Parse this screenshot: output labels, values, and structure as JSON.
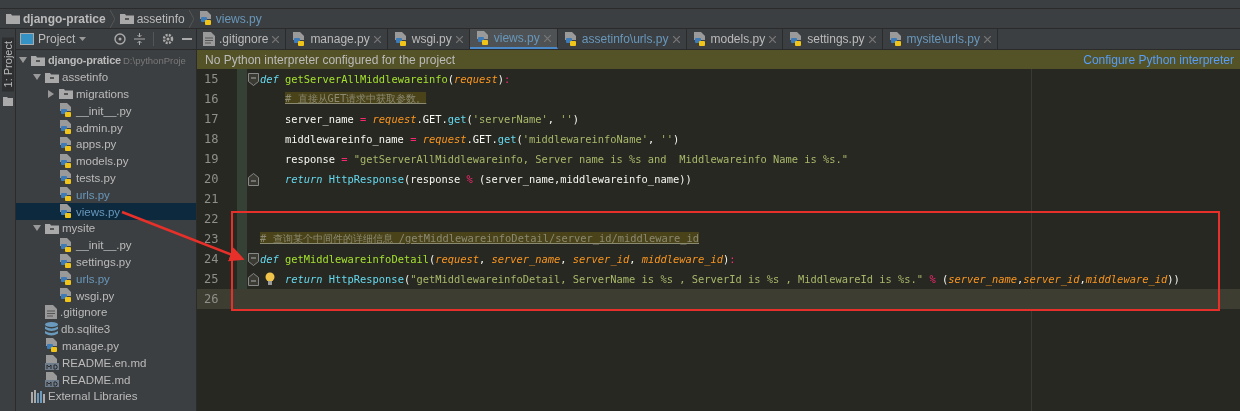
{
  "breadcrumb": [
    {
      "label": "django-pratice",
      "kind": "project",
      "modified": false
    },
    {
      "label": "assetinfo",
      "kind": "folder",
      "modified": false
    },
    {
      "label": "views.py",
      "kind": "python",
      "modified": true
    }
  ],
  "side_strip": {
    "label": "1: Project"
  },
  "project_panel": {
    "title": "Project",
    "tree": [
      {
        "label": "django-pratice",
        "path": "D:\\pythonProje",
        "kind": "folder",
        "expanded": true,
        "selected": false,
        "modified": false,
        "children": [
          {
            "label": "assetinfo",
            "kind": "folder",
            "expanded": true,
            "selected": false,
            "modified": false,
            "children": [
              {
                "label": "migrations",
                "kind": "folder",
                "expanded": false,
                "selected": false,
                "modified": false
              },
              {
                "label": "__init__.py",
                "kind": "python",
                "selected": false,
                "modified": false
              },
              {
                "label": "admin.py",
                "kind": "python",
                "selected": false,
                "modified": false
              },
              {
                "label": "apps.py",
                "kind": "python",
                "selected": false,
                "modified": false
              },
              {
                "label": "models.py",
                "kind": "python",
                "selected": false,
                "modified": false
              },
              {
                "label": "tests.py",
                "kind": "python",
                "selected": false,
                "modified": false
              },
              {
                "label": "urls.py",
                "kind": "python",
                "selected": false,
                "modified": true
              },
              {
                "label": "views.py",
                "kind": "python",
                "selected": true,
                "modified": true
              }
            ]
          },
          {
            "label": "mysite",
            "kind": "folder",
            "expanded": true,
            "selected": false,
            "modified": false,
            "children": [
              {
                "label": "__init__.py",
                "kind": "python",
                "selected": false,
                "modified": false
              },
              {
                "label": "settings.py",
                "kind": "python",
                "selected": false,
                "modified": false
              },
              {
                "label": "urls.py",
                "kind": "python",
                "selected": false,
                "modified": true
              },
              {
                "label": "wsgi.py",
                "kind": "python",
                "selected": false,
                "modified": false
              }
            ]
          },
          {
            "label": ".gitignore",
            "kind": "text",
            "selected": false,
            "modified": false
          },
          {
            "label": "db.sqlite3",
            "kind": "database",
            "selected": false,
            "modified": false
          },
          {
            "label": "manage.py",
            "kind": "python",
            "selected": false,
            "modified": false
          },
          {
            "label": "README.en.md",
            "kind": "markdown",
            "selected": false,
            "modified": false
          },
          {
            "label": "README.md",
            "kind": "markdown",
            "selected": false,
            "modified": false
          }
        ]
      },
      {
        "label": "External Libraries",
        "kind": "library",
        "selected": false,
        "modified": false
      }
    ]
  },
  "tabs": [
    {
      "label": ".gitignore",
      "kind": "text",
      "selected": false,
      "modified": false
    },
    {
      "label": "manage.py",
      "kind": "python",
      "selected": false,
      "modified": false
    },
    {
      "label": "wsgi.py",
      "kind": "python",
      "selected": false,
      "modified": false
    },
    {
      "label": "views.py",
      "kind": "python",
      "selected": true,
      "modified": true
    },
    {
      "label": "assetinfo\\urls.py",
      "kind": "python",
      "selected": false,
      "modified": true
    },
    {
      "label": "models.py",
      "kind": "python",
      "selected": false,
      "modified": false
    },
    {
      "label": "settings.py",
      "kind": "python",
      "selected": false,
      "modified": false
    },
    {
      "label": "mysite\\urls.py",
      "kind": "python",
      "selected": false,
      "modified": true
    }
  ],
  "banner": {
    "message": "No Python interpreter configured for the project",
    "action": "Configure Python interpreter"
  },
  "code_lines": [
    {
      "number": "15",
      "kind": "fold-start",
      "indented": false,
      "current": false,
      "tokens": [
        {
          "kind": "keyword",
          "text": "def "
        },
        {
          "kind": "function",
          "text": "getServerAllMiddlewareinfo"
        },
        {
          "kind": "plain",
          "text": "("
        },
        {
          "kind": "param",
          "text": "request"
        },
        {
          "kind": "plain",
          "text": ")"
        },
        {
          "kind": "operator",
          "text": ":"
        }
      ]
    },
    {
      "number": "16",
      "kind": "plain",
      "indented": true,
      "current": false,
      "tokens": [
        {
          "kind": "comment",
          "text": "# 直接从GET请求中获取参数。"
        }
      ]
    },
    {
      "number": "17",
      "kind": "plain",
      "indented": true,
      "current": false,
      "tokens": [
        {
          "kind": "plain",
          "text": "server_name "
        },
        {
          "kind": "operator",
          "text": "= "
        },
        {
          "kind": "param",
          "text": "request"
        },
        {
          "kind": "plain",
          "text": ".GET."
        },
        {
          "kind": "builtin",
          "text": "get"
        },
        {
          "kind": "plain",
          "text": "("
        },
        {
          "kind": "string",
          "text": "'serverName'"
        },
        {
          "kind": "plain",
          "text": ", "
        },
        {
          "kind": "string",
          "text": "''"
        },
        {
          "kind": "plain",
          "text": ")"
        }
      ]
    },
    {
      "number": "18",
      "kind": "plain",
      "indented": true,
      "current": false,
      "tokens": [
        {
          "kind": "plain",
          "text": "middlewareinfo_name "
        },
        {
          "kind": "operator",
          "text": "= "
        },
        {
          "kind": "param",
          "text": "request"
        },
        {
          "kind": "plain",
          "text": ".GET."
        },
        {
          "kind": "builtin",
          "text": "get"
        },
        {
          "kind": "plain",
          "text": "("
        },
        {
          "kind": "string",
          "text": "'middlewareinfoName'"
        },
        {
          "kind": "plain",
          "text": ", "
        },
        {
          "kind": "string",
          "text": "''"
        },
        {
          "kind": "plain",
          "text": ")"
        }
      ]
    },
    {
      "number": "19",
      "kind": "plain",
      "indented": true,
      "current": false,
      "tokens": [
        {
          "kind": "plain",
          "text": "response "
        },
        {
          "kind": "operator",
          "text": "= "
        },
        {
          "kind": "string",
          "text": "\"getServerAllMiddlewareinfo, Server name is %s and  Middlewareinfo Name is %s.\""
        }
      ]
    },
    {
      "number": "20",
      "kind": "fold-end",
      "indented": true,
      "current": false,
      "tokens": [
        {
          "kind": "keyword",
          "text": "return "
        },
        {
          "kind": "builtin",
          "text": "HttpResponse"
        },
        {
          "kind": "plain",
          "text": "(response "
        },
        {
          "kind": "operator",
          "text": "% "
        },
        {
          "kind": "plain",
          "text": "(server_name,middlewareinfo_name))"
        }
      ]
    },
    {
      "number": "21",
      "kind": "plain",
      "current": false
    },
    {
      "number": "22",
      "kind": "plain",
      "current": false
    },
    {
      "number": "23",
      "kind": "plain",
      "indented": false,
      "current": false,
      "tokens": [
        {
          "kind": "comment",
          "text": "# 查询某个中间件的详细信息 /getMiddlewareinfoDetail/server_id/middleware_id"
        }
      ]
    },
    {
      "number": "24",
      "kind": "fold-start",
      "indented": false,
      "current": false,
      "tokens": [
        {
          "kind": "keyword",
          "text": "def "
        },
        {
          "kind": "function",
          "text": "getMiddlewareinfoDetail"
        },
        {
          "kind": "plain",
          "text": "("
        },
        {
          "kind": "param",
          "text": "request"
        },
        {
          "kind": "plain",
          "text": ", "
        },
        {
          "kind": "param",
          "text": "server_name"
        },
        {
          "kind": "plain",
          "text": ", "
        },
        {
          "kind": "param",
          "text": "server_id"
        },
        {
          "kind": "plain",
          "text": ", "
        },
        {
          "kind": "param",
          "text": "middleware_id"
        },
        {
          "kind": "plain",
          "text": ")"
        },
        {
          "kind": "operator",
          "text": ":"
        }
      ]
    },
    {
      "number": "25",
      "kind": "fold-end",
      "indented": true,
      "current": false,
      "bulb": true,
      "tokens": [
        {
          "kind": "keyword",
          "text": "return "
        },
        {
          "kind": "builtin",
          "text": "HttpResponse"
        },
        {
          "kind": "plain",
          "text": "("
        },
        {
          "kind": "string",
          "text": "\"getMiddlewareinfoDetail, ServerName is %s , ServerId is %s , MiddlewareId is %s.\""
        },
        {
          "kind": "operator",
          "text": " % "
        },
        {
          "kind": "plain",
          "text": "("
        },
        {
          "kind": "param",
          "text": "server_name"
        },
        {
          "kind": "plain",
          "text": ","
        },
        {
          "kind": "param",
          "text": "server_id"
        },
        {
          "kind": "plain",
          "text": ","
        },
        {
          "kind": "param",
          "text": "middleware_id"
        },
        {
          "kind": "plain",
          "text": "))"
        }
      ]
    },
    {
      "number": "26",
      "kind": "plain",
      "current": true
    }
  ]
}
